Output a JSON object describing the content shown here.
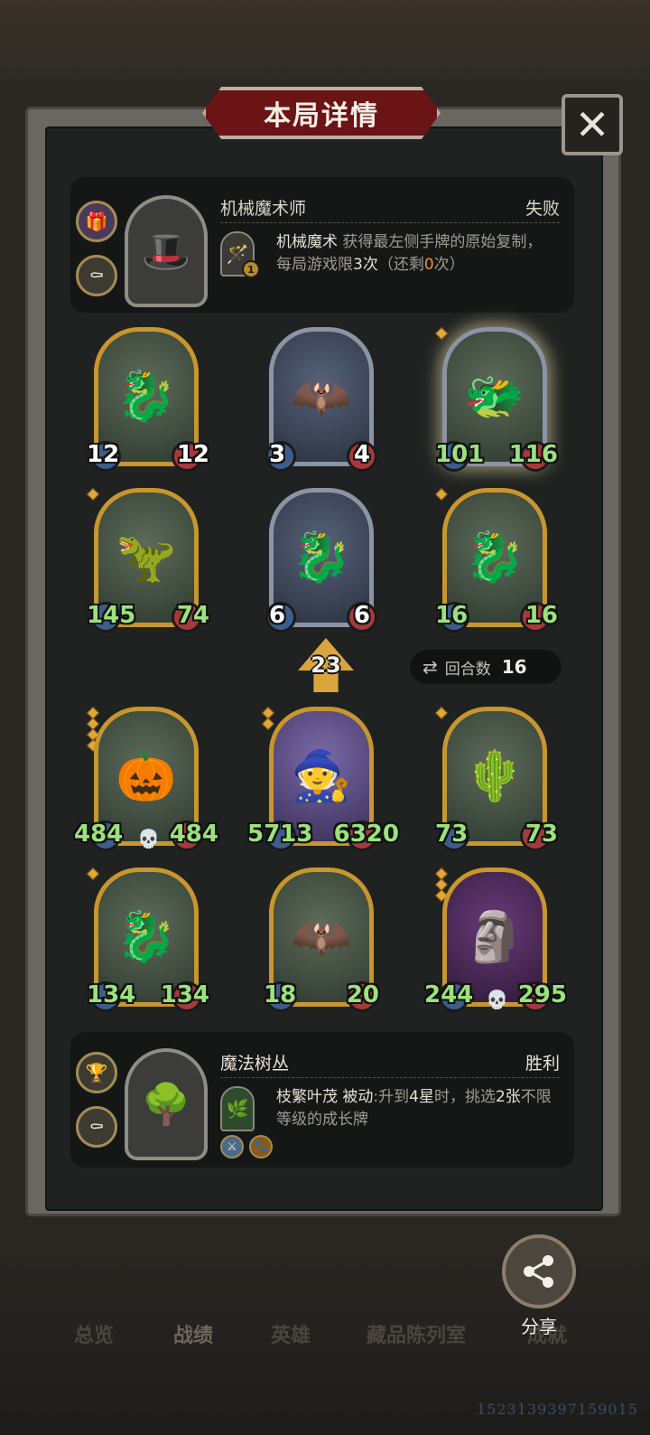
{
  "header": {
    "title": "本局详情",
    "close_icon": "✕"
  },
  "player_top": {
    "hero_name": "机械魔术师",
    "result": "失败",
    "skill_name": "机械魔术",
    "skill_desc_a": "获得最左侧手牌的原始复制，每局游戏限",
    "skill_limit": "3次",
    "skill_desc_b": "（还剩",
    "skill_remaining": "0",
    "skill_desc_c": "次）",
    "skill_level": "1"
  },
  "units_top": [
    {
      "atk": "12",
      "hp": "12"
    },
    {
      "atk": "3",
      "hp": "4"
    },
    {
      "atk": "101",
      "hp": "116"
    },
    {
      "atk": "145",
      "hp": "74"
    },
    {
      "atk": "6",
      "hp": "6"
    },
    {
      "atk": "16",
      "hp": "16"
    }
  ],
  "turn_indicator": {
    "value": "23"
  },
  "rounds": {
    "label": "回合数",
    "value": "16"
  },
  "units_bottom": [
    {
      "atk": "484",
      "hp": "484"
    },
    {
      "atk": "5713",
      "hp": "6320"
    },
    {
      "atk": "73",
      "hp": "73"
    },
    {
      "atk": "134",
      "hp": "134"
    },
    {
      "atk": "18",
      "hp": "20"
    },
    {
      "atk": "244",
      "hp": "295"
    }
  ],
  "player_bottom": {
    "hero_name": "魔法树丛",
    "result": "胜利",
    "skill_name": "枝繁叶茂",
    "skill_tag": "被动",
    "skill_desc_a": ":升到",
    "skill_star": "4星",
    "skill_desc_b": "时，挑选",
    "skill_count": "2张",
    "skill_desc_c": "不限等级的成长牌"
  },
  "share": {
    "label": "分享"
  },
  "bottom_nav": [
    "总览",
    "战绩",
    "英雄",
    "藏品陈列室",
    "成就"
  ],
  "watermark": "1523139397159015"
}
